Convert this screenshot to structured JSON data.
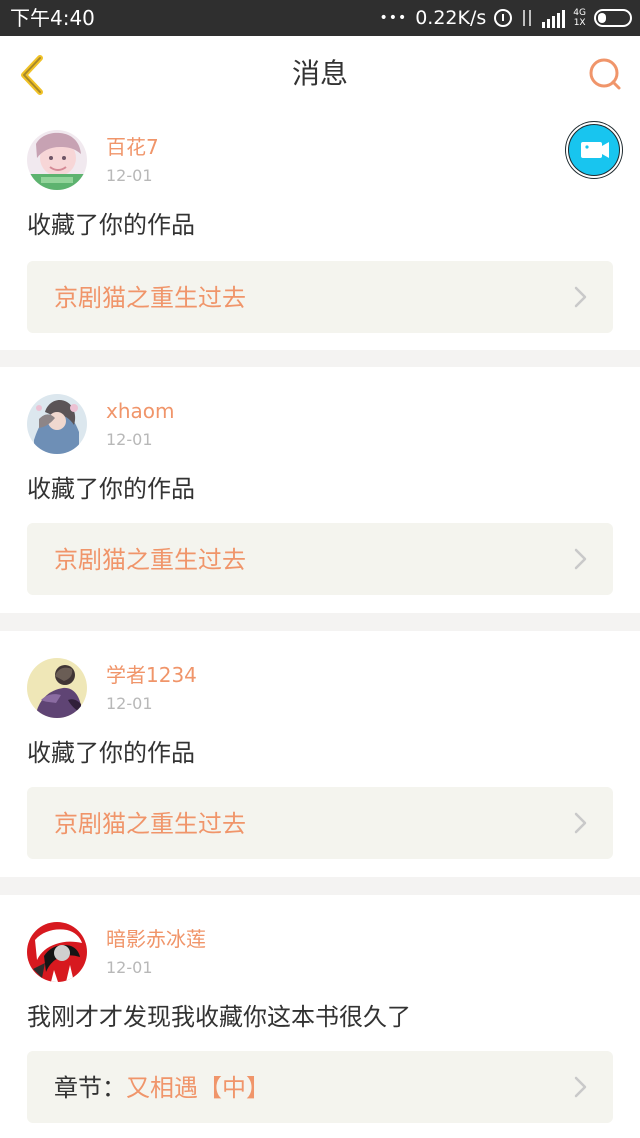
{
  "status_bar": {
    "time": "下午4:40",
    "dots": "•••",
    "speed": "0.22K/s",
    "net_label_top": "4G",
    "net_label_bottom": "1X"
  },
  "header": {
    "title": "消息"
  },
  "accent_color": "#f0956a",
  "messages": [
    {
      "username": "百花7",
      "date": "12-01",
      "text": "收藏了你的作品",
      "work_title": "京剧猫之重生过去"
    },
    {
      "username": "xhaom",
      "date": "12-01",
      "text": "收藏了你的作品",
      "work_title": "京剧猫之重生过去"
    },
    {
      "username": "学者1234",
      "date": "12-01",
      "text": "收藏了你的作品",
      "work_title": "京剧猫之重生过去"
    },
    {
      "username": "暗影赤冰莲",
      "date": "12-01",
      "text": "我刚才才发现我收藏你这本书很久了",
      "chapter_prefix": "章节：",
      "chapter_title": "又相遇【中】"
    }
  ]
}
